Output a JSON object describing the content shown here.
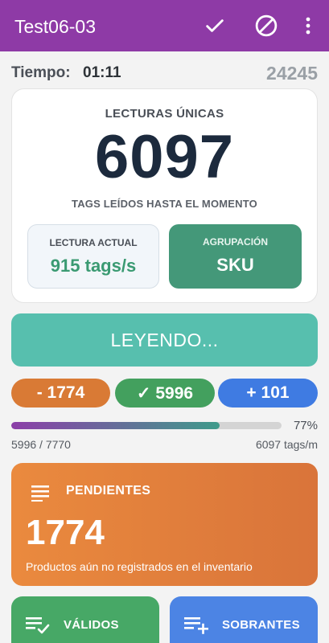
{
  "appbar": {
    "title": "Test06-03",
    "background": "#8e3aa6",
    "actions": [
      "check-icon",
      "block-icon",
      "more-vert-icon"
    ]
  },
  "status": {
    "time_label": "Tiempo:",
    "time_value": "01:11",
    "total_count": "24245"
  },
  "unique": {
    "label": "LECTURAS ÚNICAS",
    "value": "6097",
    "sub_label": "TAGS LEÍDOS HASTA EL MOMENTO"
  },
  "rate": {
    "label": "LECTURA ACTUAL",
    "value": "915 tags/s"
  },
  "grouping": {
    "label": "AGRUPACIÓN",
    "value": "SKU"
  },
  "reading_button": {
    "label": "LEYENDO...",
    "color": "#57bfae"
  },
  "pills": {
    "missing": "- 1774",
    "valid": "✓ 5996",
    "extra": "+ 101",
    "colors": {
      "missing": "#d97a35",
      "valid": "#43a05e",
      "extra": "#3f7be2"
    }
  },
  "progress": {
    "fraction": 0.77,
    "percent_label": "77%",
    "count_label": "5996 / 7770",
    "rate_label": "6097 tags/m"
  },
  "pending": {
    "icon": "list-icon",
    "title": "PENDIENTES",
    "value": "1774",
    "description": "Productos aún no registrados en el inventario"
  },
  "valid": {
    "icon": "playlist-check-icon",
    "title": "VÁLIDOS"
  },
  "extra": {
    "icon": "playlist-add-icon",
    "title": "SOBRANTES"
  }
}
